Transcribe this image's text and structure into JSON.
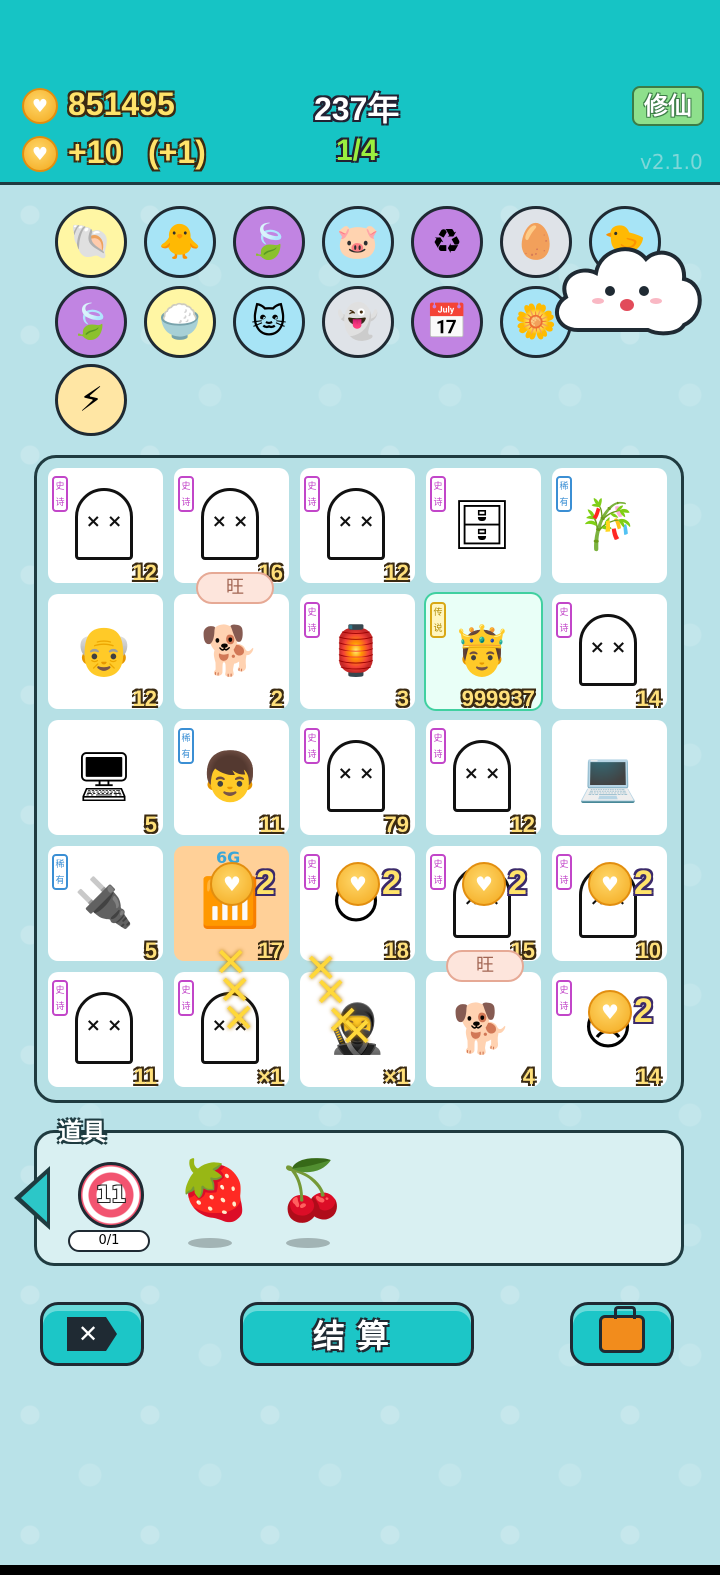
{
  "header": {
    "coins": "851495",
    "coin_rate": "+10",
    "coin_bonus": "(+1)",
    "year": "237年",
    "progress": "1/4",
    "cultivate_button": "修仙",
    "version": "v2.1.0"
  },
  "orbs_row1": [
    {
      "icon": "shell-icon",
      "glyph": "🐚",
      "color": "y"
    },
    {
      "icon": "chick-egg-icon",
      "glyph": "🐥",
      "color": "b"
    },
    {
      "icon": "leaf-icon",
      "glyph": "🍃",
      "color": "p"
    },
    {
      "icon": "piggy-bank-icon",
      "glyph": "🐷",
      "color": "b"
    },
    {
      "icon": "recycle-icon",
      "glyph": "♻",
      "color": "p"
    },
    {
      "icon": "egg-tray-icon",
      "glyph": "🥚",
      "color": "g"
    },
    {
      "icon": "chick-icon",
      "glyph": "🐤",
      "color": "b"
    }
  ],
  "orbs_row2": [
    {
      "icon": "leaf-icon",
      "glyph": "🍃",
      "color": "p"
    },
    {
      "icon": "rice-bowl-icon",
      "glyph": "🍚",
      "color": "y"
    },
    {
      "icon": "cat-icon",
      "glyph": "🐱",
      "color": "b"
    },
    {
      "icon": "ghost-icon",
      "glyph": "👻",
      "color": "g"
    },
    {
      "icon": "calendar-icon",
      "glyph": "📅",
      "color": "p"
    },
    {
      "icon": "flower-pot-icon",
      "glyph": "🌼",
      "color": "b"
    }
  ],
  "orbs_row3": [
    {
      "icon": "lightning-icon",
      "glyph": "⚡",
      "color": "o"
    }
  ],
  "board": {
    "rows": [
      [
        {
          "tag": "史诗",
          "tag_color": "purple",
          "icon": "ghost",
          "count": "12"
        },
        {
          "tag": "史诗",
          "tag_color": "purple",
          "icon": "ghost",
          "count": "16"
        },
        {
          "tag": "史诗",
          "tag_color": "purple",
          "icon": "ghost",
          "count": "12"
        },
        {
          "tag": "史诗",
          "tag_color": "purple",
          "icon": "server",
          "count": ""
        },
        {
          "tag": "稀有",
          "tag_color": "blue",
          "icon": "bamboo",
          "count": ""
        }
      ],
      [
        {
          "tag": "",
          "tag_color": "",
          "icon": "old-man",
          "count": "12"
        },
        {
          "tag": "",
          "tag_color": "",
          "icon": "dog",
          "count": "2"
        },
        {
          "tag": "史诗",
          "tag_color": "purple",
          "icon": "house",
          "count": "3"
        },
        {
          "tag": "传说",
          "tag_color": "gold",
          "icon": "king",
          "count": "999937"
        },
        {
          "tag": "史诗",
          "tag_color": "purple",
          "icon": "ghost",
          "count": "14"
        }
      ],
      [
        {
          "tag": "",
          "tag_color": "",
          "icon": "monitor",
          "count": "5"
        },
        {
          "tag": "稀有",
          "tag_color": "blue",
          "icon": "boy",
          "count": "11"
        },
        {
          "tag": "史诗",
          "tag_color": "purple",
          "icon": "ghost",
          "count": "79"
        },
        {
          "tag": "史诗",
          "tag_color": "purple",
          "icon": "ghost",
          "count": "12"
        },
        {
          "tag": "",
          "tag_color": "",
          "icon": "desktop",
          "count": ""
        }
      ],
      [
        {
          "tag": "稀有",
          "tag_color": "blue",
          "icon": "pc-tower",
          "count": "5"
        },
        {
          "tag": "",
          "tag_color": "",
          "icon": "signal-6g",
          "count": "17"
        },
        {
          "tag": "史诗",
          "tag_color": "purple",
          "icon": "yellow-face",
          "count": "18"
        },
        {
          "tag": "史诗",
          "tag_color": "purple",
          "icon": "ghost",
          "count": "15"
        },
        {
          "tag": "史诗",
          "tag_color": "purple",
          "icon": "ghost",
          "count": "10"
        }
      ],
      [
        {
          "tag": "史诗",
          "tag_color": "purple",
          "icon": "ghost",
          "count": "11"
        },
        {
          "tag": "史诗",
          "tag_color": "purple",
          "icon": "ghost",
          "count": "×1"
        },
        {
          "tag": "",
          "tag_color": "",
          "icon": "thief",
          "count": "×1"
        },
        {
          "tag": "",
          "tag_color": "",
          "icon": "dog",
          "count": "4"
        },
        {
          "tag": "史诗",
          "tag_color": "purple",
          "icon": "robber",
          "count": "14"
        }
      ]
    ],
    "bubble_text": "旺",
    "six_g_label": "6G",
    "coin_gain": "2"
  },
  "tools": {
    "title": "道具",
    "target_number": "11",
    "target_usage": "0/1"
  },
  "actions": {
    "settle_label": "结算"
  },
  "colors": {
    "header_bg": "#16c4c5",
    "coin_text": "#ffe36a",
    "progress_text": "#9aef3f",
    "epic_tag": "#c246c9",
    "rare_tag": "#3b8fd4"
  }
}
